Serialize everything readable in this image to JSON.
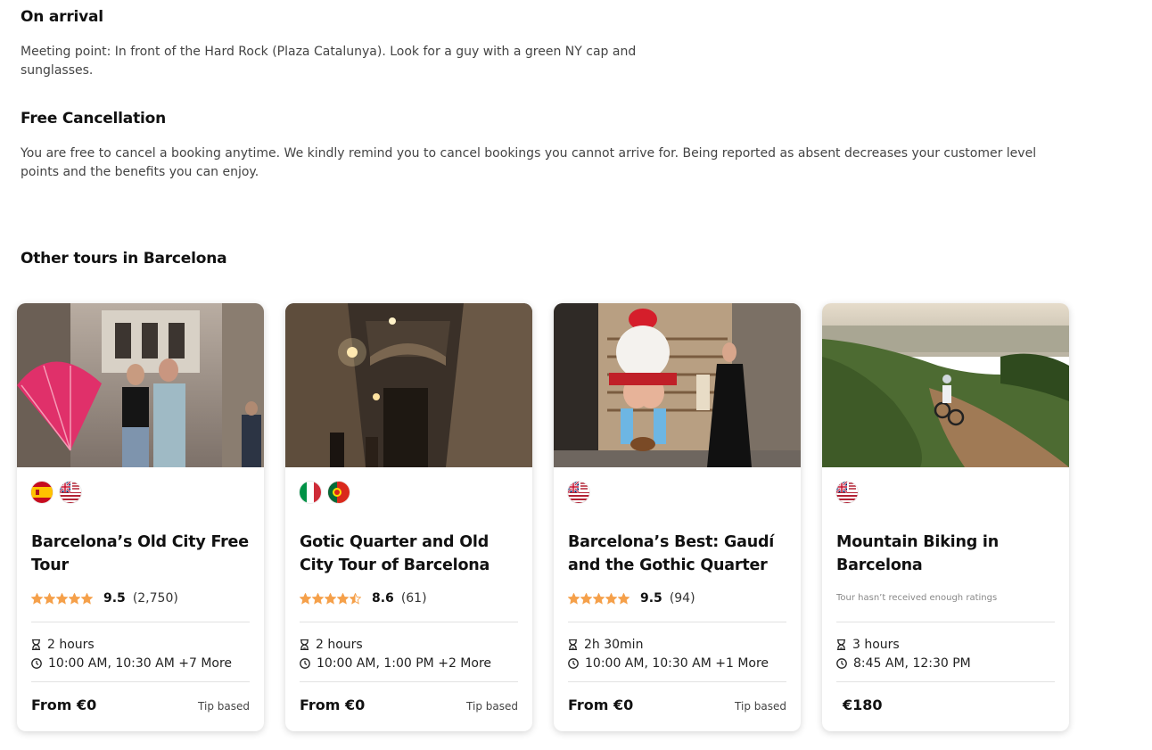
{
  "arrival": {
    "title": "On arrival",
    "text": "Meeting point: In front of the Hard Rock (Plaza Catalunya). Look for a guy with a green NY cap and sunglasses."
  },
  "cancellation": {
    "title": "Free Cancellation",
    "text": "You are free to cancel a booking anytime. We kindly remind you to cancel bookings you cannot arrive for. Being reported as absent decreases your customer level points and the benefits you can enjoy."
  },
  "other_tours": {
    "title": "Other tours in Barcelona",
    "cards": [
      {
        "title": "Barcelona’s Old City Free Tour",
        "flags": [
          "spain-flag-icon",
          "uk-us-flag-icon"
        ],
        "stars": 5,
        "score": "9.5",
        "count": "(2,750)",
        "duration": "2 hours",
        "times": "10:00 AM, 10:30 AM +7 More",
        "price": "From €0",
        "tip": "Tip based"
      },
      {
        "title": "Gotic Quarter and Old City Tour of Barcelona",
        "flags": [
          "italy-flag-icon",
          "portugal-flag-icon"
        ],
        "stars": 4.5,
        "score": "8.6",
        "count": "(61)",
        "duration": "2 hours",
        "times": "10:00 AM, 1:00 PM +2 More",
        "price": "From €0",
        "tip": "Tip based"
      },
      {
        "title": "Barcelona’s Best: Gaudí and the Gothic Quarter",
        "flags": [
          "uk-us-flag-icon"
        ],
        "stars": 5,
        "score": "9.5",
        "count": "(94)",
        "duration": "2h 30min",
        "times": "10:00 AM, 10:30 AM +1 More",
        "price": "From €0",
        "tip": "Tip based"
      },
      {
        "title": "Mountain Biking in Barcelona",
        "flags": [
          "uk-us-flag-icon"
        ],
        "no_ratings": "Tour hasn’t received enough ratings",
        "duration": "3 hours",
        "times": "8:45 AM, 12:30 PM",
        "price": "€180"
      }
    ]
  },
  "colors": {
    "star": "#f5a04a",
    "star_empty": "#f5a04a"
  }
}
